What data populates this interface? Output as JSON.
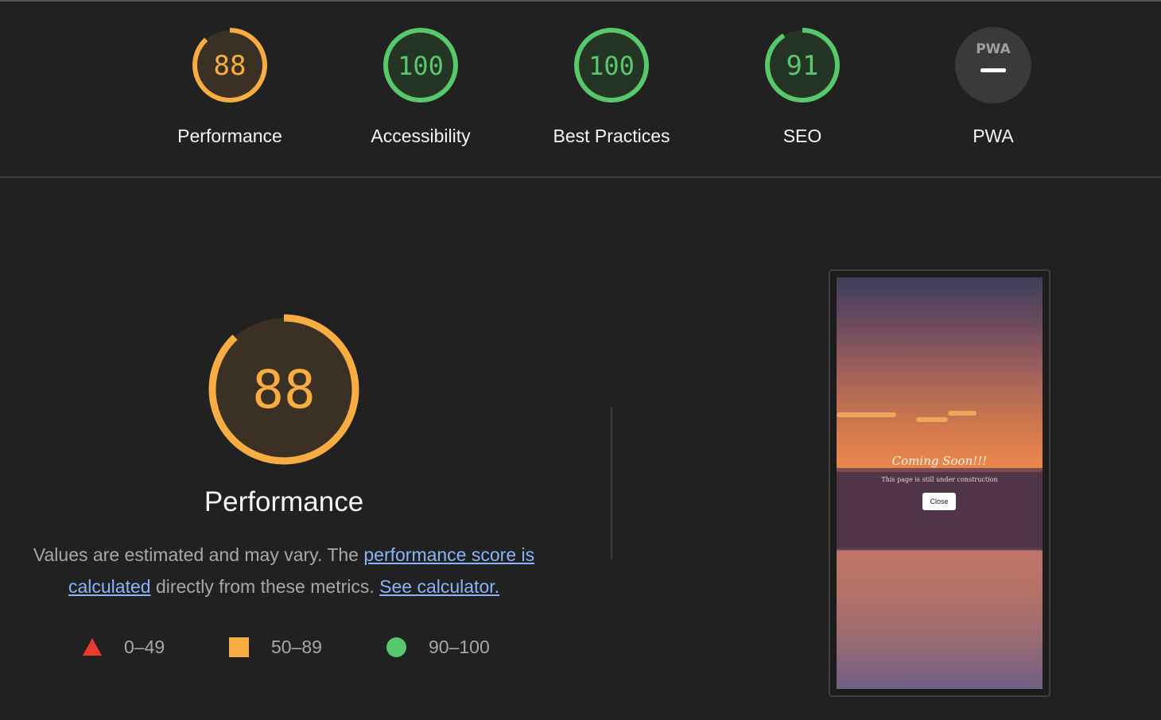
{
  "categories": [
    {
      "id": "performance",
      "label": "Performance",
      "score": "88",
      "fraction": 0.88,
      "color": "#f7ad41",
      "fill": "#3a3024"
    },
    {
      "id": "accessibility",
      "label": "Accessibility",
      "score": "100",
      "fraction": 1.0,
      "color": "#57c86b",
      "fill": "#253525"
    },
    {
      "id": "best-practices",
      "label": "Best Practices",
      "score": "100",
      "fraction": 1.0,
      "color": "#57c86b",
      "fill": "#253525"
    },
    {
      "id": "seo",
      "label": "SEO",
      "score": "91",
      "fraction": 0.91,
      "color": "#57c86b",
      "fill": "#253525"
    },
    {
      "id": "pwa",
      "label": "PWA",
      "badge": "PWA",
      "color": "#3a3a3a"
    }
  ],
  "main": {
    "score": "88",
    "fraction": 0.88,
    "title": "Performance",
    "desc_prefix": "Values are estimated and may vary. The ",
    "desc_link1": "performance score is calculated",
    "desc_middle": " directly from these metrics. ",
    "desc_link2": "See calculator."
  },
  "legend": [
    {
      "shape": "triangle",
      "range": "0–49",
      "color": "#eb3b2f"
    },
    {
      "shape": "square",
      "range": "50–89",
      "color": "#f7ad41"
    },
    {
      "shape": "circle",
      "range": "90–100",
      "color": "#57c86b"
    }
  ],
  "screenshot": {
    "heading": "Coming Soon!!!",
    "subtext": "This page is still under construction",
    "button": "Close"
  }
}
